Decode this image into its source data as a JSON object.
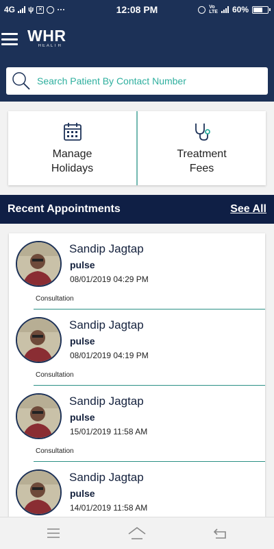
{
  "status_bar": {
    "network": "4G",
    "time": "12:08 PM",
    "battery": "60%",
    "dots": "···"
  },
  "header": {
    "logo_text": "WHR",
    "logo_sub": "HEALTH",
    "menu_icon": "hamburger-menu-icon"
  },
  "search": {
    "placeholder": "Search Patient By Contact Number",
    "value": "",
    "icon": "search-icon"
  },
  "quick_actions": [
    {
      "label": "Manage\nHolidays",
      "icon": "calendar-icon"
    },
    {
      "label": "Treatment\nFees",
      "icon": "stethoscope-icon"
    }
  ],
  "recent": {
    "title": "Recent Appointments",
    "see_all": "See All"
  },
  "appointments": [
    {
      "name": "Sandip Jagtap",
      "org": "pulse",
      "datetime": "08/01/2019 04:29 PM",
      "type": "Consultation"
    },
    {
      "name": "Sandip Jagtap",
      "org": "pulse",
      "datetime": "08/01/2019 04:19 PM",
      "type": "Consultation"
    },
    {
      "name": "Sandip Jagtap",
      "org": "pulse",
      "datetime": "15/01/2019 11:58 AM",
      "type": "Consultation"
    },
    {
      "name": "Sandip Jagtap",
      "org": "pulse",
      "datetime": "14/01/2019 11:58 AM",
      "type": ""
    }
  ],
  "nav": {
    "menu_icon": "recent-apps-icon",
    "home_icon": "home-icon",
    "back_icon": "back-icon"
  },
  "colors": {
    "header": "#1c3157",
    "section_bar": "#0f1f45",
    "accent": "#2eaf9e"
  }
}
